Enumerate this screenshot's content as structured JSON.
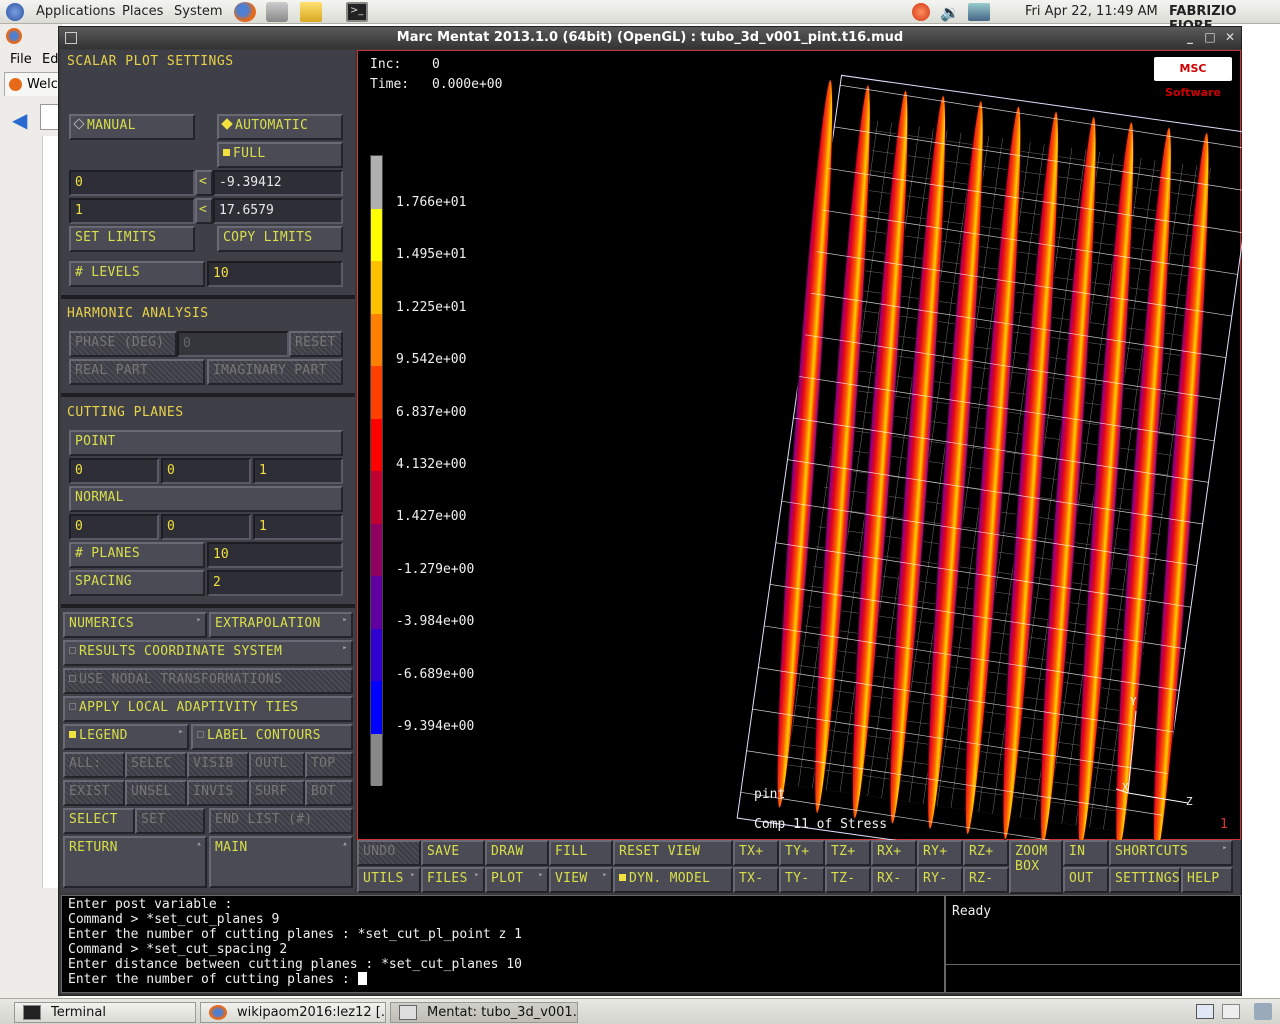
{
  "top_panel": {
    "applications": "Applications",
    "places": "Places",
    "system": "System",
    "clock": "Fri Apr 22, 11:49 AM",
    "user": "FABRIZIO FIORE"
  },
  "bg_browser": {
    "file": "File",
    "edit": "Ed",
    "tab": "Welco"
  },
  "window": {
    "title": "Marc Mentat 2013.1.0 (64bit) (OpenGL) : tubo_3d_v001_pint.t16.mud"
  },
  "scalar": {
    "title": "SCALAR PLOT SETTINGS",
    "manual": "MANUAL",
    "automatic": "AUTOMATIC",
    "full": "FULL",
    "min_left": "0",
    "min_val": "-9.39412",
    "max_left": "1",
    "max_val": "17.6579",
    "set_limits": "SET LIMITS",
    "copy_limits": "COPY LIMITS",
    "levels": "# LEVELS",
    "levels_val": "10"
  },
  "harmonic": {
    "title": "HARMONIC ANALYSIS",
    "phase": "PHASE (DEG)",
    "phase_val": "0",
    "reset": "RESET",
    "real": "REAL PART",
    "imag": "IMAGINARY PART"
  },
  "cutting": {
    "title": "CUTTING PLANES",
    "point": "POINT",
    "p1": "0",
    "p2": "0",
    "p3": "1",
    "normal": "NORMAL",
    "n1": "0",
    "n2": "0",
    "n3": "1",
    "planes": "# PLANES",
    "planes_val": "10",
    "spacing": "SPACING",
    "spacing_val": "2"
  },
  "misc": {
    "numerics": "NUMERICS",
    "extrapolation": "EXTRAPOLATION",
    "results_cs": "RESULTS COORDINATE SYSTEM",
    "nodal_tr": "USE NODAL TRANSFORMATIONS",
    "adaptivity": "APPLY LOCAL ADAPTIVITY TIES",
    "legend": "LEGEND",
    "label_contours": "LABEL CONTOURS",
    "all": "ALL:",
    "selec": "SELEC",
    "visib": "VISIB",
    "outl": "OUTL",
    "top": "TOP",
    "exist": "EXIST",
    "unsel": "UNSEL",
    "invis": "INVIS",
    "surf": "SURF",
    "bot": "BOT",
    "select": "SELECT",
    "set": "SET",
    "end_list": "END LIST (#)",
    "return": "RETURN",
    "main": "MAIN"
  },
  "view": {
    "inc_label": "Inc:",
    "inc_val": "0",
    "time_label": "Time:",
    "time_val": "0.000e+00",
    "var_name": "pint",
    "var_desc": "Comp 11 of Stress",
    "corner_num": "1",
    "logo": "MSC Software",
    "axis_x": "X",
    "axis_y": "Y",
    "axis_z": "Z",
    "legend": [
      "1.766e+01",
      "1.495e+01",
      "1.225e+01",
      "9.542e+00",
      "6.837e+00",
      "4.132e+00",
      "1.427e+00",
      "-1.279e+00",
      "-3.984e+00",
      "-6.689e+00",
      "-9.394e+00"
    ],
    "legend_colors": [
      "#b0b0b0",
      "#ffff00",
      "#ffc000",
      "#ff8000",
      "#ff4000",
      "#ff0000",
      "#c00030",
      "#900060",
      "#6000a0",
      "#3000d0",
      "#0000ff",
      "#888888"
    ]
  },
  "toolbar": {
    "undo": "UNDO",
    "save": "SAVE",
    "draw": "DRAW",
    "fill": "FILL",
    "reset_view": "RESET VIEW",
    "txp": "TX+",
    "typ": "TY+",
    "tzp": "TZ+",
    "rxp": "RX+",
    "ryp": "RY+",
    "rzp": "RZ+",
    "zoom": "ZOOM",
    "box": "BOX",
    "in": "IN",
    "shortcuts": "SHORTCUTS",
    "utils": "UTILS",
    "files": "FILES",
    "plot": "PLOT",
    "view": "VIEW",
    "dyn": "DYN. MODEL",
    "txm": "TX-",
    "tym": "TY-",
    "tzm": "TZ-",
    "rxm": "RX-",
    "rym": "RY-",
    "rzm": "RZ-",
    "out": "OUT",
    "settings": "SETTINGS",
    "help": "HELP"
  },
  "command_lines": [
    "Enter post variable :",
    "Command > *set_cut_planes 9",
    "Enter the number of cutting planes : *set_cut_pl_point z 1",
    "Command > *set_cut_spacing 2",
    "Enter distance between cutting planes : *set_cut_planes 10",
    "Enter the number of cutting planes : "
  ],
  "status": {
    "text": "Ready"
  },
  "taskbar": {
    "t1": "Terminal",
    "t2": "wikipaom2016:lez12 [...",
    "t3": "Mentat: tubo_3d_v001..."
  }
}
